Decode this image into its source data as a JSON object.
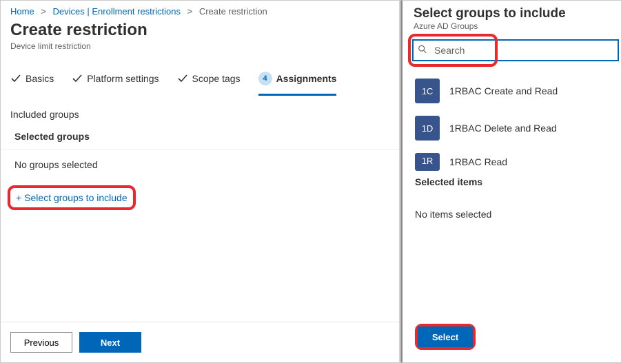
{
  "breadcrumb": {
    "items": [
      {
        "label": "Home",
        "link": true
      },
      {
        "label": "Devices | Enrollment restrictions",
        "link": true
      },
      {
        "label": "Create restriction",
        "link": false
      }
    ],
    "sep": ">"
  },
  "header": {
    "title": "Create restriction",
    "subtitle": "Device limit restriction"
  },
  "steps": [
    {
      "label": "Basics",
      "done": true
    },
    {
      "label": "Platform settings",
      "done": true
    },
    {
      "label": "Scope tags",
      "done": true
    },
    {
      "label": "Assignments",
      "num": "4",
      "active": true
    }
  ],
  "included": {
    "section_label": "Included groups",
    "selected_header": "Selected groups",
    "empty_text": "No groups selected",
    "add_link": "Select groups to include"
  },
  "footer": {
    "prev": "Previous",
    "next": "Next"
  },
  "panel": {
    "title": "Select groups to include",
    "subtitle": "Azure AD Groups",
    "search_placeholder": "Search",
    "groups": [
      {
        "initials": "1C",
        "name": "1RBAC Create and Read"
      },
      {
        "initials": "1D",
        "name": "1RBAC Delete and Read"
      },
      {
        "initials": "1R",
        "name": "1RBAC Read"
      }
    ],
    "selected_header": "Selected items",
    "selected_empty": "No items selected",
    "select_btn": "Select"
  }
}
